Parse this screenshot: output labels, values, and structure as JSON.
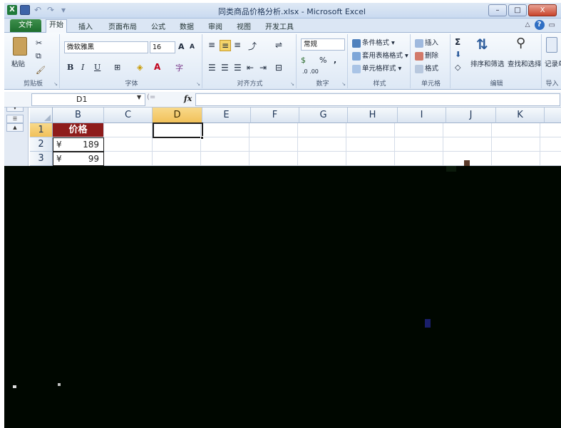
{
  "window": {
    "title": "同类商品价格分析.xlsx - Microsoft Excel",
    "minimize": "–",
    "maximize": "□",
    "close": "X"
  },
  "ribbon_tabs": [
    "文件",
    "开始",
    "插入",
    "页面布局",
    "公式",
    "数据",
    "审阅",
    "视图",
    "开发工具"
  ],
  "ribbon": {
    "clipboard": {
      "paste": "粘贴",
      "label": "剪贴板"
    },
    "font": {
      "name": "微软雅黑",
      "size": "16",
      "bold": "B",
      "italic": "I",
      "underline": "U",
      "grow": "A",
      "shrink": "A",
      "label": "字体"
    },
    "alignment": {
      "label": "对齐方式"
    },
    "number": {
      "format": "常规",
      "percent": "%",
      "comma": ",",
      "inc_dec": ".0 .00",
      "label": "数字"
    },
    "styles": {
      "conditional": "条件格式",
      "table": "套用表格格式",
      "cell": "单元格样式",
      "label": "样式"
    },
    "cells": {
      "insert": "插入",
      "delete": "删除",
      "format": "格式",
      "label": "单元格"
    },
    "editing": {
      "sum": "Σ",
      "sort": "排序和筛选",
      "find": "查找和选择",
      "label": "编辑"
    },
    "extra": {
      "record": "记录单",
      "import": "导入"
    }
  },
  "formula_bar": {
    "name_box": "D1",
    "fx": "fx",
    "formula": ""
  },
  "grid": {
    "columns": [
      "B",
      "C",
      "D",
      "E",
      "F",
      "G",
      "H",
      "I",
      "J",
      "K"
    ],
    "selected_column": "D",
    "rows": [
      {
        "n": "1",
        "b": "价格"
      },
      {
        "n": "2",
        "currency": "¥",
        "value": "189"
      },
      {
        "n": "3",
        "currency": "¥",
        "value": "99"
      }
    ],
    "active_cell": "D1"
  },
  "colors": {
    "header_fill": "#8e1c1b",
    "selected_header": "#f1c15a",
    "file_tab": "#1d6e2e"
  }
}
